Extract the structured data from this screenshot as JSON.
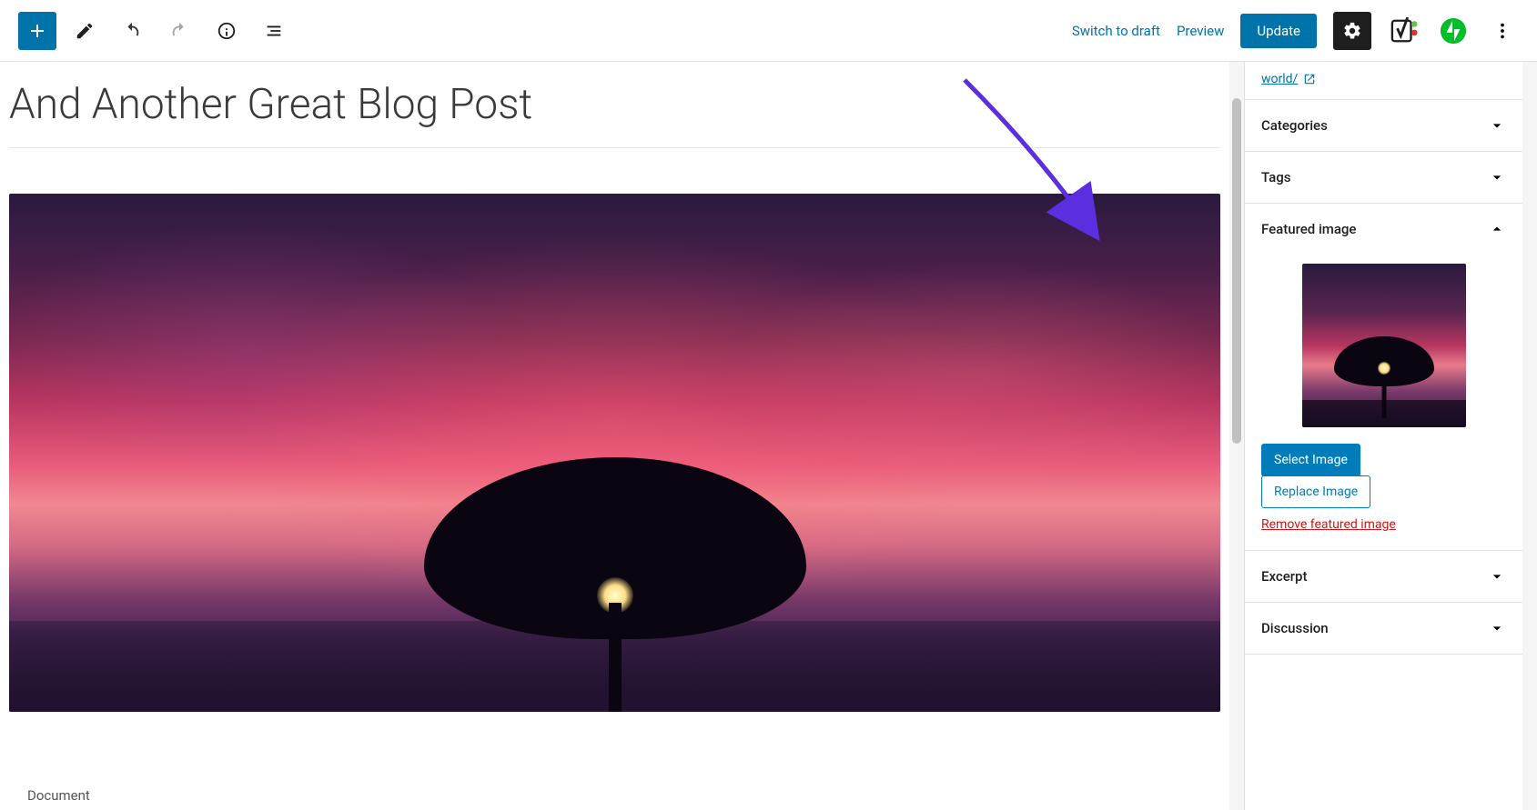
{
  "toolbar": {
    "switch_to_draft": "Switch to draft",
    "preview": "Preview",
    "update": "Update"
  },
  "editor": {
    "title": "And Another Great Blog Post",
    "doc_label": "Document"
  },
  "sidebar": {
    "permalink_text": "world/",
    "panels": {
      "categories": "Categories",
      "tags": "Tags",
      "featured_image": "Featured image",
      "excerpt": "Excerpt",
      "discussion": "Discussion"
    },
    "featured_image": {
      "select_image": "Select Image",
      "replace_image": "Replace Image",
      "remove_image": "Remove featured image"
    }
  }
}
